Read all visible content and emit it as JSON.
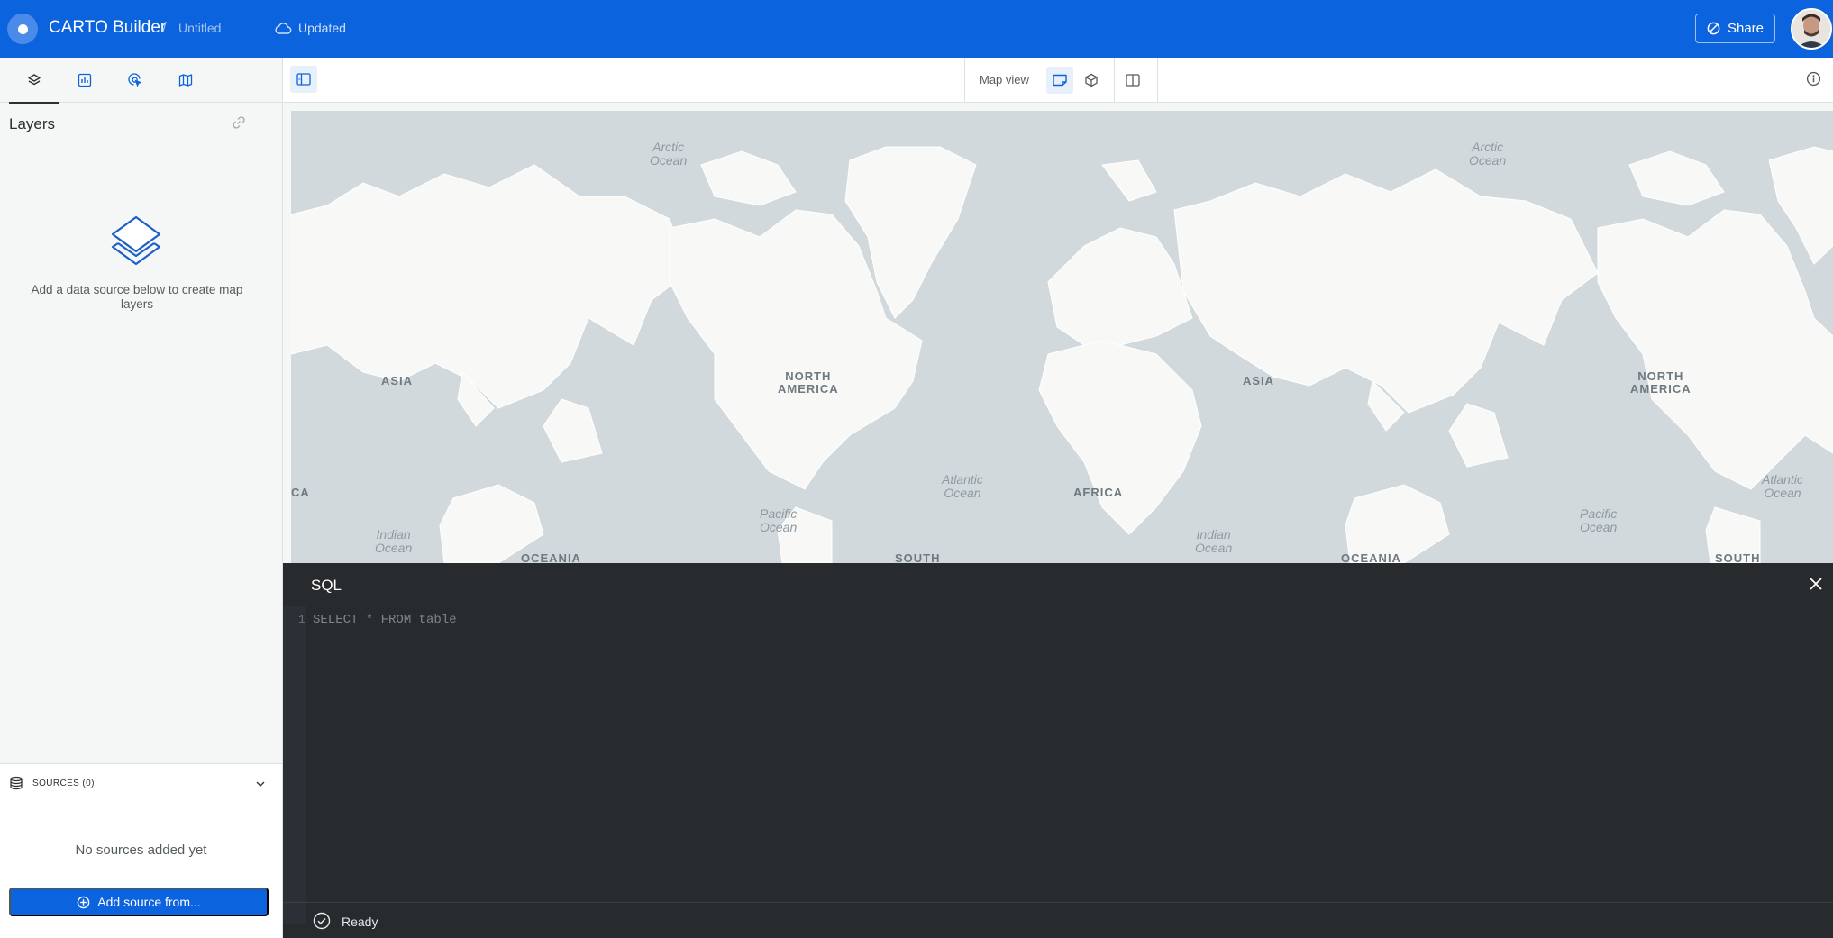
{
  "header": {
    "app_title": "CARTO Builder",
    "separator": "/",
    "map_name": "Untitled",
    "save_status": "Updated",
    "share_label": "Share",
    "brand_color": "#0c63de"
  },
  "sidebar": {
    "tabs": [
      {
        "icon": "layers-icon"
      },
      {
        "icon": "widgets-chart-icon"
      },
      {
        "icon": "interactions-cursor-icon"
      },
      {
        "icon": "basemap-icon"
      }
    ],
    "active_tab": 0,
    "layers_title": "Layers",
    "empty_layers_text": "Add a data source below to create map layers",
    "sources_label": "SOURCES (0)",
    "no_sources_text": "No sources added yet",
    "add_source_label": "Add source from..."
  },
  "toolbar": {
    "map_view_label": "Map view"
  },
  "map": {
    "continents": [
      {
        "text": "ASIA"
      },
      {
        "text": "NORTH\nAMERICA"
      },
      {
        "text": "AFRICA"
      },
      {
        "text": "ASIA"
      },
      {
        "text": "NORTH\nAMERICA"
      },
      {
        "text": "OCEANIA"
      },
      {
        "text": "OCEANIA"
      },
      {
        "text": "SOUTH"
      },
      {
        "text": "SOUTH"
      },
      {
        "text": "CA"
      }
    ],
    "oceans": [
      {
        "text": "Arctic\nOcean"
      },
      {
        "text": "Arctic\nOcean"
      },
      {
        "text": "Atlantic\nOcean"
      },
      {
        "text": "Atlantic\nOcean"
      },
      {
        "text": "Pacific\nOcean"
      },
      {
        "text": "Pacific\nOcean"
      },
      {
        "text": "Indian\nOcean"
      },
      {
        "text": "Indian\nOcean"
      }
    ]
  },
  "sql": {
    "title": "SQL",
    "line_number": "1",
    "placeholder_code": "SELECT * FROM table",
    "status": "Ready"
  }
}
